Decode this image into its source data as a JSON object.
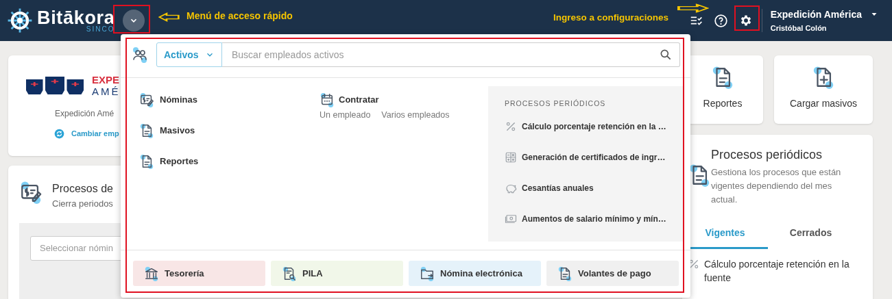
{
  "header": {
    "brand": "Bitākora",
    "brand_sub": "SINCO",
    "company": "Expedición América",
    "user": "Cristóbal Colón"
  },
  "annotations": [
    {
      "kind": "left",
      "text": "Menú de acceso rápido"
    },
    {
      "kind": "right",
      "text": "Ingreso a configuraciones"
    }
  ],
  "company_card": {
    "logo_top": "EXPE",
    "logo_bottom": "AMÉ",
    "company": "Expedición Amé",
    "link": "Cambiar emp"
  },
  "payroll_card": {
    "title": "Procesos de",
    "subtitle": "Cierra periodos",
    "select_placeholder": "Seleccionar nómin"
  },
  "shortcuts": [
    {
      "kind": "report",
      "label": "Reportes"
    },
    {
      "kind": "upload",
      "label": "Cargar masivos"
    }
  ],
  "periodic_card": {
    "title": "Procesos periódicos",
    "description": "Gestiona los procesos que están vigentes dependiendo del mes actual.",
    "tabs": [
      {
        "label": "Vigentes",
        "selected": true
      },
      {
        "label": "Cerrados",
        "selected": false
      }
    ],
    "items": [
      {
        "text": "Cálculo porcentaje retención en la fuente"
      }
    ]
  },
  "quick_menu": {
    "filter": "Activos",
    "search_placeholder": "Buscar empleados activos",
    "links": [
      {
        "kind": "payroll",
        "label": "Nóminas"
      },
      {
        "kind": "document",
        "label": "Masivos"
      },
      {
        "kind": "document",
        "label": "Reportes"
      }
    ],
    "hire": {
      "label": "Contratar",
      "options": [
        "Un empleado",
        "Varios empleados"
      ]
    },
    "periodic": {
      "heading": "PROCESOS PERIÓDICOS",
      "items": [
        {
          "kind": "percent",
          "text": "Cálculo porcentaje retención en la …"
        },
        {
          "kind": "calculator",
          "text": "Generación de certificados de ingr…"
        },
        {
          "kind": "piggy",
          "text": "Cesantías anuales"
        },
        {
          "kind": "money",
          "text": "Aumentos de salario mínimo y mín…"
        }
      ]
    },
    "footer": [
      {
        "kind": "bank",
        "label": "Tesorería",
        "color": "#f8e6e6"
      },
      {
        "kind": "docsearch",
        "label": "PILA",
        "color": "#f1f7e9"
      },
      {
        "kind": "folder",
        "label": "Nómina electrónica",
        "color": "#e5f2fa"
      },
      {
        "kind": "document",
        "label": "Volantes de pago",
        "color": "#f0f0f0"
      }
    ]
  }
}
